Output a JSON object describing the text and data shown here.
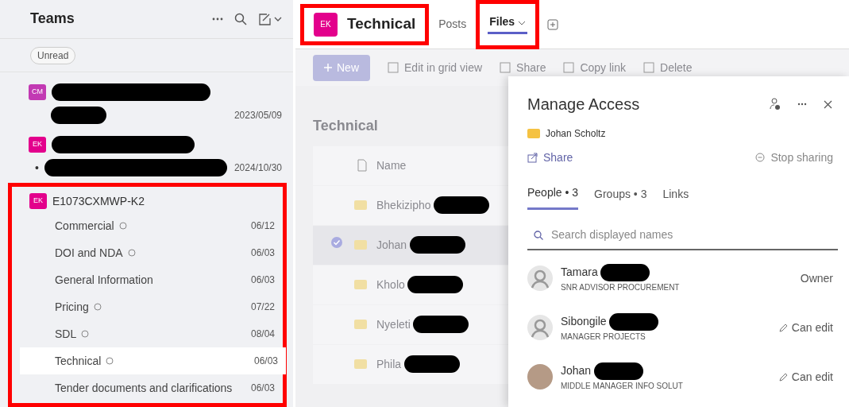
{
  "sidebar": {
    "title": "Teams",
    "filter": "Unread",
    "teams": [
      {
        "initials": "CM",
        "color": "#c239b3",
        "redacted": true,
        "sub_redacted": true,
        "date": "2023/05/09",
        "highlighted": false
      },
      {
        "initials": "EK",
        "color": "#e3008c",
        "redacted": true,
        "sub_redacted": true,
        "bullet": "•",
        "date": "2024/10/30",
        "highlighted": false
      },
      {
        "initials": "EK",
        "color": "#e3008c",
        "name": "E1073CXMWP-K2",
        "redacted": false,
        "sub_redacted": false,
        "highlighted": true,
        "channels": [
          {
            "name": "Commercial",
            "status_icon": true,
            "date": "06/12",
            "selected": false
          },
          {
            "name": "DOI and NDA",
            "status_icon": true,
            "date": "06/03",
            "selected": false
          },
          {
            "name": "General Information",
            "status_icon": false,
            "date": "06/03",
            "selected": false
          },
          {
            "name": "Pricing",
            "status_icon": true,
            "date": "07/22",
            "selected": false
          },
          {
            "name": "SDL",
            "status_icon": true,
            "date": "08/04",
            "selected": false
          },
          {
            "name": "Technical",
            "status_icon": true,
            "date": "06/03",
            "selected": true
          },
          {
            "name": "Tender documents and clarifications",
            "status_icon": false,
            "date": "06/03",
            "selected": false
          }
        ]
      }
    ]
  },
  "header": {
    "initials": "EK",
    "title": "Technical",
    "highlighted": true,
    "tabs": [
      {
        "label": "Posts",
        "selected": false,
        "dropdown": false,
        "highlighted": false
      },
      {
        "label": "Files",
        "selected": true,
        "dropdown": true,
        "highlighted": true
      }
    ]
  },
  "toolbar": {
    "new": "New",
    "actions": [
      "Edit in grid view",
      "Share",
      "Copy link",
      "Delete"
    ]
  },
  "files": {
    "title": "Technical",
    "column": "Name",
    "rows": [
      {
        "name": "Bhekizipho",
        "redacted": true,
        "selected": false
      },
      {
        "name": "Johan",
        "redacted": true,
        "selected": true
      },
      {
        "name": "Kholo",
        "redacted": true,
        "selected": false
      },
      {
        "name": "Nyeleti",
        "redacted": true,
        "selected": false
      },
      {
        "name": "Phila",
        "redacted": true,
        "selected": false
      }
    ]
  },
  "manage_access": {
    "title": "Manage Access",
    "item": "Johan Scholtz",
    "share": "Share",
    "stop_sharing": "Stop sharing",
    "tabs": [
      {
        "label": "People • 3",
        "selected": true
      },
      {
        "label": "Groups • 3",
        "selected": false
      },
      {
        "label": "Links",
        "selected": false
      }
    ],
    "search": {
      "placeholder": "Search displayed names"
    },
    "people": [
      {
        "name": "Tamara",
        "redacted": true,
        "role": "SNR ADVISOR PROCUREMENT",
        "permission": "Owner",
        "permission_icon": false,
        "kind": "silhouette"
      },
      {
        "name": "Sibongile",
        "redacted": true,
        "role": "MANAGER PROJECTS",
        "permission": "Can edit",
        "permission_icon": true,
        "kind": "silhouette"
      },
      {
        "name": "Johan",
        "redacted": true,
        "role": "MIDDLE MANAGER INFO SOLUT",
        "permission": "Can edit",
        "permission_icon": true,
        "kind": "photo"
      }
    ]
  }
}
